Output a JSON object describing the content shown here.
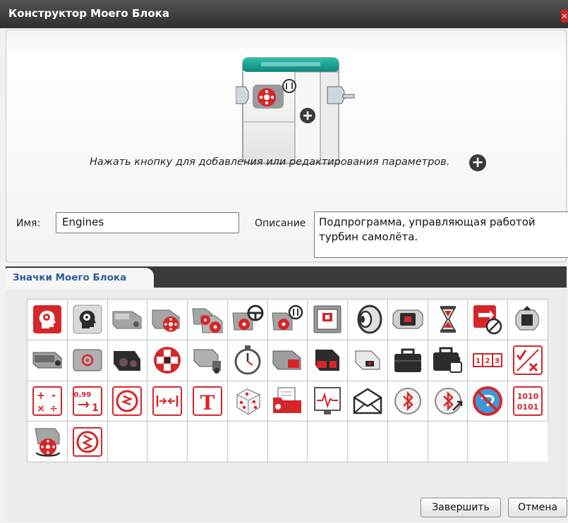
{
  "window": {
    "title": "Конструктор Моего Блока"
  },
  "editor": {
    "instruction": "Нажать кнопку для добавления или редактирования параметров.",
    "name_label": "Имя:",
    "name_value": "Engines",
    "description_label": "Описание",
    "description_value": "Подпрограмма, управляющая работой турбин самолёта."
  },
  "icons_tab": {
    "label": "Значки Моего Блока"
  },
  "icon_grid": {
    "rows": 4,
    "columns": 13,
    "icons": [
      "gear-head-red-icon",
      "gear-head-dark-icon",
      "large-motor-icon",
      "large-motor-red-icon",
      "two-large-motors-icon",
      "motors-steering-icon",
      "motors-tank-icon",
      "display-icon",
      "sound-icon",
      "brick-status-light-icon",
      "timer-hourglass-icon",
      "loop-interrupt-icon",
      "brick-arrow-icon",
      "medium-motor-icon",
      "motor-rotation-icon",
      "ultrasonic-sensor-icon",
      "brick-buttons-icon",
      "touch-sensor-icon",
      "stopwatch-icon",
      "infrared-sensor-icon",
      "infrared-beacon-icon",
      "color-sensor-icon",
      "toolbox-icon",
      "locked-toolbox-icon",
      "array-icon",
      "logic-operations-icon",
      "math-icon",
      "round-icon",
      "compare-icon",
      "range-icon",
      "text-icon",
      "random-icon",
      "file-access-icon",
      "data-logging-icon",
      "messaging-icon",
      "bluetooth-icon",
      "bluetooth-connection-icon",
      "keep-awake-icon",
      "raw-sensor-value-icon",
      "unregulated-motor-icon",
      "invert-motor-icon"
    ],
    "empty_cells": 10
  },
  "buttons": {
    "finish": "Завершить",
    "cancel": "Отмена"
  },
  "colors": {
    "accent_red": "#d6262a",
    "title_bar": "#3b3b3b",
    "tab_text": "#2e5b9a",
    "block_teal": "#1d9d8c"
  }
}
